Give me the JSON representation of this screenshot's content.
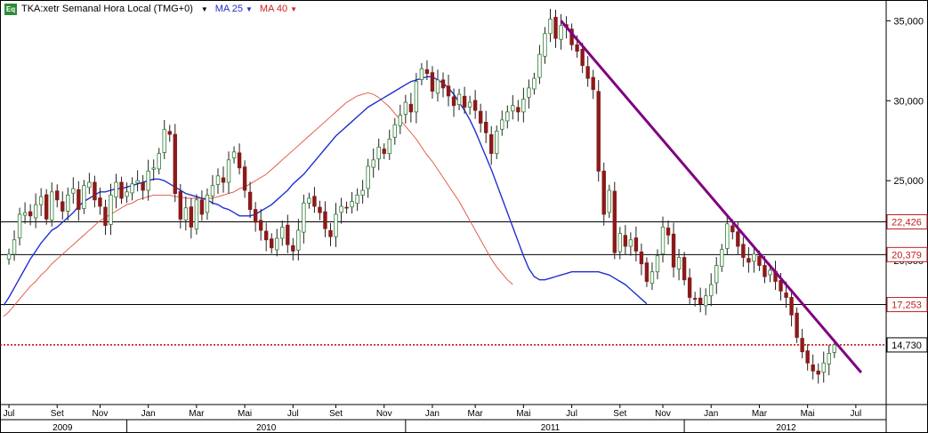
{
  "header": {
    "badge": "Eq",
    "symbol": "TKA:xetr Semanal Hora Local (TMG+0)",
    "ma25_label": "MA 25",
    "ma40_label": "MA 40",
    "caret": "▼"
  },
  "colors": {
    "ma25": "#1f2fd0",
    "ma40": "#e05040",
    "trendline": "#800080",
    "bull": "#2e7d32",
    "bear": "#8b1a1a",
    "current_price": "#cc0000"
  },
  "chart_data": {
    "type": "candlestick",
    "y_axis": {
      "range": [
        11000,
        36300
      ],
      "ticks": [
        "35,000",
        "30,000",
        "25,000",
        "20,000"
      ],
      "tick_values": [
        35000,
        30000,
        25000,
        20000
      ],
      "side": "right"
    },
    "x_axis": {
      "month_labels": [
        "Jul",
        "Set",
        "Nov",
        "Jan",
        "Mar",
        "Mai",
        "Jul",
        "Set",
        "Nov",
        "Jan",
        "Mar",
        "Mai",
        "Jul",
        "Set",
        "Nov",
        "Jan",
        "Mar",
        "Mai",
        "Jul"
      ],
      "month_weeks": [
        1,
        10,
        18,
        27,
        36,
        45,
        54,
        62,
        71,
        80,
        88,
        97,
        106,
        115,
        123,
        132,
        141,
        150,
        159
      ],
      "year_labels": [
        "2009",
        "2010",
        "2011",
        "2012"
      ],
      "year_weeks": [
        11,
        49,
        102,
        146
      ],
      "year_separator_weeks": [
        23,
        75,
        127
      ]
    },
    "horizontal_levels": [
      {
        "value": 22426,
        "label": "22,426",
        "style": "solid"
      },
      {
        "value": 20379,
        "label": "20,379",
        "style": "solid"
      },
      {
        "value": 17253,
        "label": "17,253",
        "style": "solid"
      }
    ],
    "current_price": {
      "value": 14730,
      "label": "14,730"
    },
    "trendlines": [
      {
        "from": {
          "week": 104,
          "value": 35000
        },
        "to": {
          "week": 160,
          "value": 13000
        }
      }
    ],
    "candles_weekly_closes": [
      20400,
      21300,
      22900,
      23000,
      22800,
      23500,
      24000,
      22600,
      24300,
      23800,
      23100,
      24100,
      24500,
      23200,
      24700,
      24900,
      23800,
      23400,
      22200,
      24100,
      24900,
      23900,
      24300,
      24800,
      25000,
      24400,
      25600,
      25800,
      26700,
      28200,
      27900,
      24200,
      22600,
      23300,
      22100,
      23800,
      22900,
      24100,
      24700,
      25300,
      24900,
      26300,
      26800,
      25800,
      24400,
      23200,
      22400,
      21900,
      21300,
      20800,
      21400,
      22100,
      21000,
      20600,
      21900,
      23600,
      23900,
      23400,
      23000,
      22000,
      21500,
      22900,
      23400,
      23300,
      23700,
      24100,
      24400,
      25900,
      26300,
      27100,
      26700,
      27600,
      28500,
      29100,
      29900,
      29300,
      31200,
      32000,
      31700,
      30600,
      31300,
      30800,
      30300,
      29700,
      30400,
      29600,
      29900,
      29400,
      28600,
      28000,
      26700,
      28100,
      28800,
      29300,
      29700,
      29300,
      30100,
      30800,
      31400,
      32900,
      34200,
      35100,
      33900,
      34700,
      34600,
      33500,
      33100,
      32200,
      31400,
      30700,
      25600,
      22900,
      24400,
      20500,
      21700,
      20900,
      21300,
      20600,
      19800,
      18700,
      19300,
      20300,
      22100,
      21600,
      19600,
      20200,
      18800,
      17700,
      17600,
      17300,
      17800,
      18500,
      19700,
      20700,
      22300,
      21800,
      20900,
      20200,
      19900,
      20400,
      19700,
      19000,
      19400,
      18700,
      18100,
      17700,
      16600,
      15200,
      14300,
      13600,
      13100,
      12900,
      13600,
      14200,
      14730
    ],
    "ma25_values": [
      17200,
      17700,
      18300,
      18900,
      19500,
      20100,
      20600,
      21100,
      21500,
      21900,
      22100,
      22400,
      22700,
      23000,
      23400,
      23700,
      23900,
      24100,
      24300,
      24300,
      24400,
      24500,
      24500,
      24600,
      24700,
      24800,
      24900,
      25000,
      25100,
      25100,
      25000,
      24800,
      24600,
      24400,
      24200,
      24100,
      24000,
      23900,
      23800,
      23600,
      23500,
      23300,
      23200,
      23000,
      22800,
      22800,
      22800,
      22900,
      23100,
      23300,
      23500,
      23800,
      24100,
      24400,
      24800,
      25100,
      25400,
      25800,
      26200,
      26600,
      27000,
      27400,
      27800,
      28100,
      28400,
      28700,
      29000,
      29300,
      29600,
      29800,
      30000,
      30200,
      30400,
      30600,
      30800,
      31000,
      31200,
      31300,
      31400,
      31500,
      31500,
      31300,
      31100,
      30800,
      30400,
      29900,
      29400,
      28800,
      28100,
      27300,
      26500,
      25700,
      24800,
      23900,
      23000,
      22100,
      21200,
      20300,
      19500,
      19000,
      18800,
      18800,
      18900,
      19000,
      19100,
      19200,
      19300,
      19300,
      19300,
      19300,
      19300,
      19300,
      19200,
      19100,
      18900,
      18700,
      18500,
      18200,
      17900,
      17600,
      17300
    ],
    "ma40_values": [
      16500,
      16800,
      17200,
      17600,
      18000,
      18400,
      18700,
      19100,
      19400,
      19800,
      20100,
      20400,
      20700,
      21000,
      21300,
      21600,
      21900,
      22200,
      22500,
      22700,
      22900,
      23100,
      23300,
      23500,
      23600,
      23800,
      23900,
      24000,
      24100,
      24100,
      24100,
      24100,
      24000,
      24000,
      23900,
      23900,
      23900,
      23900,
      23900,
      23900,
      24000,
      24100,
      24200,
      24300,
      24500,
      24600,
      24800,
      25000,
      25200,
      25400,
      25700,
      26000,
      26300,
      26600,
      26900,
      27200,
      27500,
      27800,
      28100,
      28400,
      28700,
      29000,
      29300,
      29600,
      29900,
      30100,
      30300,
      30400,
      30500,
      30400,
      30200,
      29900,
      29600,
      29200,
      28800,
      28400,
      28000,
      27600,
      27100,
      26600,
      26200,
      25700,
      25200,
      24700,
      24200,
      23700,
      23100,
      22500,
      21900,
      21300,
      20700,
      20100,
      19600,
      19200,
      18800,
      18500
    ]
  }
}
